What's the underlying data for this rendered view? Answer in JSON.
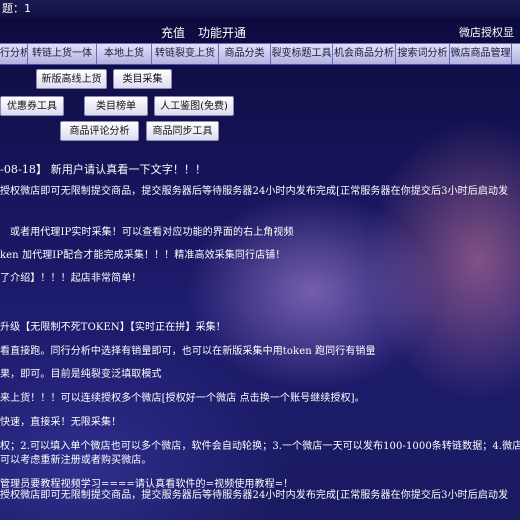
{
  "window": {
    "title": "题：1"
  },
  "top_menu": {
    "recharge": "充值",
    "activate": "功能开通",
    "shop_auth": "微店授权",
    "display": "显示"
  },
  "tabs": [
    "行分析",
    "转链上货一体",
    "本地上货",
    "转链裂变上货",
    "商品分类",
    "裂变标题工具",
    "机会商品分析",
    "搜索词分析",
    "微店商品管理"
  ],
  "buttons": {
    "new_listing": "新版高线上货",
    "category_collect": "类目采集",
    "coupon_tool": "优惠券工具",
    "category_rank": "类目榜单",
    "ai_collage": "人工鉴图(免费)",
    "review_analysis": "商品评论分析",
    "sync_tool": "商品同步工具"
  },
  "notice": [
    "-08-18】    新用户请认真看一下文字！！！",
    "授权微店即可无限制提交商品，提交服务器后等待服务器24小时内发布完成[正常服务器在你提交后3小时后启动发",
    "或者用代理IP实时采集！可以查看对应功能的界面的右上角视频",
    "ken 加代理IP配合才能完成采集！！！精准高效采集同行店铺！",
    "了介绍】！！！起店非常简单！",
    "升级【无限制不死TOKEN】【实时正在拼】采集！",
    "看直接跑。同行分析中选择有销量即可，也可以在新版采集中用token 跑同行有销量",
    "果，即可。目前是纯裂变泛填取模式",
    "来上货！！！可以连续授权多个微店[授权好一个微店 点击换一个账号继续授权]。",
    "快速，直接采！无限采集！",
    "权；2.可以填入单个微店也可以多个微店，软件会自动轮换；3.一个微店一天可以发布100-1000条转链数据；4.微店",
    "可以考虑重新注册或者购买微店。",
    "管理员要教程视频学习====请认真看软件的=视频使用教程=！",
    "授权微店即可无限制提交商品，提交服务器后等待服务器24小时内发布完成[正常服务器在你提交后3小时后启动发"
  ]
}
